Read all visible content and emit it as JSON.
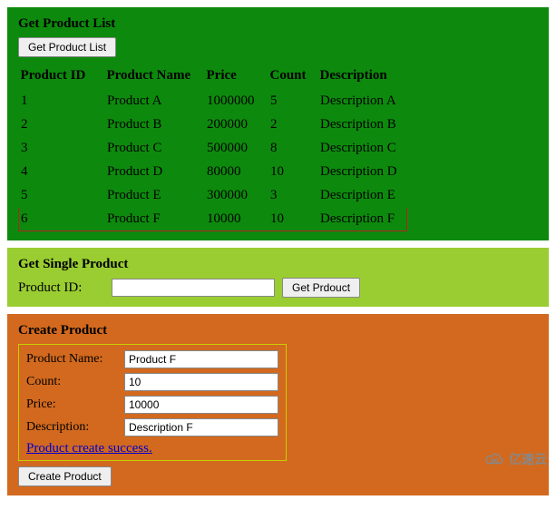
{
  "listPanel": {
    "title": "Get Product List",
    "buttonLabel": "Get Product List",
    "headers": {
      "id": "Product ID",
      "name": "Product Name",
      "price": "Price",
      "count": "Count",
      "desc": "Description"
    },
    "rows": [
      {
        "id": "1",
        "name": "Product A",
        "price": "1000000",
        "count": "5",
        "desc": "Description A"
      },
      {
        "id": "2",
        "name": "Product B",
        "price": "200000",
        "count": "2",
        "desc": "Description B"
      },
      {
        "id": "3",
        "name": "Product C",
        "price": "500000",
        "count": "8",
        "desc": "Description C"
      },
      {
        "id": "4",
        "name": "Product D",
        "price": "80000",
        "count": "10",
        "desc": "Description D"
      },
      {
        "id": "5",
        "name": "Product E",
        "price": "300000",
        "count": "3",
        "desc": "Description E"
      },
      {
        "id": "6",
        "name": "Product F",
        "price": "10000",
        "count": "10",
        "desc": "Description F"
      }
    ],
    "highlightIndex": 5
  },
  "singlePanel": {
    "title": "Get Single Product",
    "idLabel": "Product ID:",
    "idValue": "",
    "buttonLabel": "Get Prdouct"
  },
  "createPanel": {
    "title": "Create Product",
    "fields": {
      "nameLabel": "Product Name:",
      "nameValue": "Product F",
      "countLabel": "Count:",
      "countValue": "10",
      "priceLabel": "Price:",
      "priceValue": "10000",
      "descLabel": "Description:",
      "descValue": "Description F"
    },
    "status": "Product create success.",
    "buttonLabel": "Create Product"
  },
  "watermark": "亿速云"
}
